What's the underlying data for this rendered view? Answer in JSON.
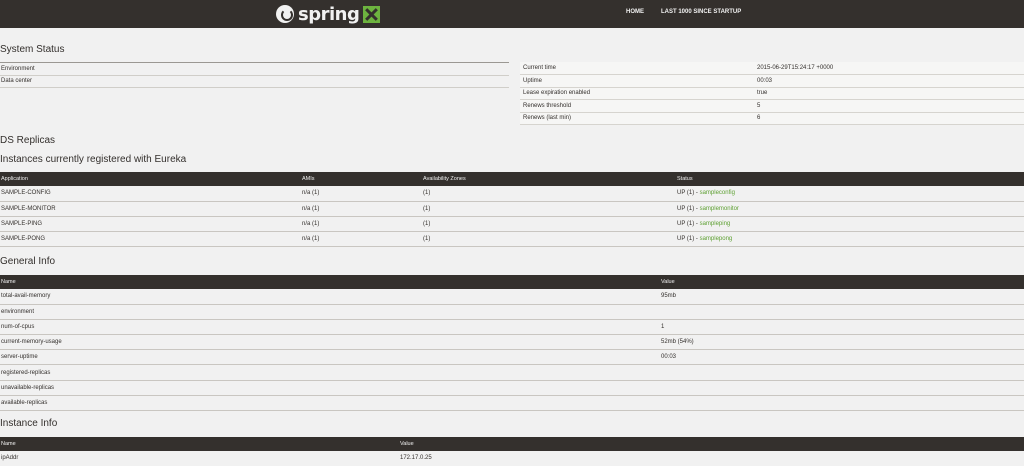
{
  "nav": {
    "logo_word": "spring",
    "home": "HOME",
    "last1000": "LAST 1000 SINCE STARTUP"
  },
  "system_status": {
    "title": "System Status",
    "left": [
      {
        "label": "Environment",
        "value": ""
      },
      {
        "label": "Data center",
        "value": ""
      }
    ],
    "right": [
      {
        "label": "Current time",
        "value": "2015-06-29T15:24:17 +0000"
      },
      {
        "label": "Uptime",
        "value": "00:03"
      },
      {
        "label": "Lease expiration enabled",
        "value": "true"
      },
      {
        "label": "Renews threshold",
        "value": "5"
      },
      {
        "label": "Renews (last min)",
        "value": "6"
      }
    ]
  },
  "ds_replicas": {
    "title": "DS Replicas"
  },
  "instances": {
    "title": "Instances currently registered with Eureka",
    "headers": [
      "Application",
      "AMIs",
      "Availability Zones",
      "Status"
    ],
    "rows": [
      {
        "app": "SAMPLE-CONFIG",
        "amis": "n/a (1)",
        "zones": "(1)",
        "status": "UP (1) - ",
        "link": "sampleconfig"
      },
      {
        "app": "SAMPLE-MONITOR",
        "amis": "n/a (1)",
        "zones": "(1)",
        "status": "UP (1) - ",
        "link": "samplemonitor"
      },
      {
        "app": "SAMPLE-PING",
        "amis": "n/a (1)",
        "zones": "(1)",
        "status": "UP (1) - ",
        "link": "sampleping"
      },
      {
        "app": "SAMPLE-PONG",
        "amis": "n/a (1)",
        "zones": "(1)",
        "status": "UP (1) - ",
        "link": "samplepong"
      }
    ]
  },
  "general_info": {
    "title": "General Info",
    "headers": [
      "Name",
      "Value"
    ],
    "rows": [
      {
        "name": "total-avail-memory",
        "value": "95mb"
      },
      {
        "name": "environment",
        "value": ""
      },
      {
        "name": "num-of-cpus",
        "value": "1"
      },
      {
        "name": "current-memory-usage",
        "value": "52mb (54%)"
      },
      {
        "name": "server-uptime",
        "value": "00:03"
      },
      {
        "name": "registered-replicas",
        "value": ""
      },
      {
        "name": "unavailable-replicas",
        "value": ""
      },
      {
        "name": "available-replicas",
        "value": ""
      }
    ]
  },
  "instance_info": {
    "title": "Instance Info",
    "headers": [
      "Name",
      "Value"
    ],
    "rows": [
      {
        "name": "ipAddr",
        "value": "172.17.0.25"
      }
    ]
  }
}
